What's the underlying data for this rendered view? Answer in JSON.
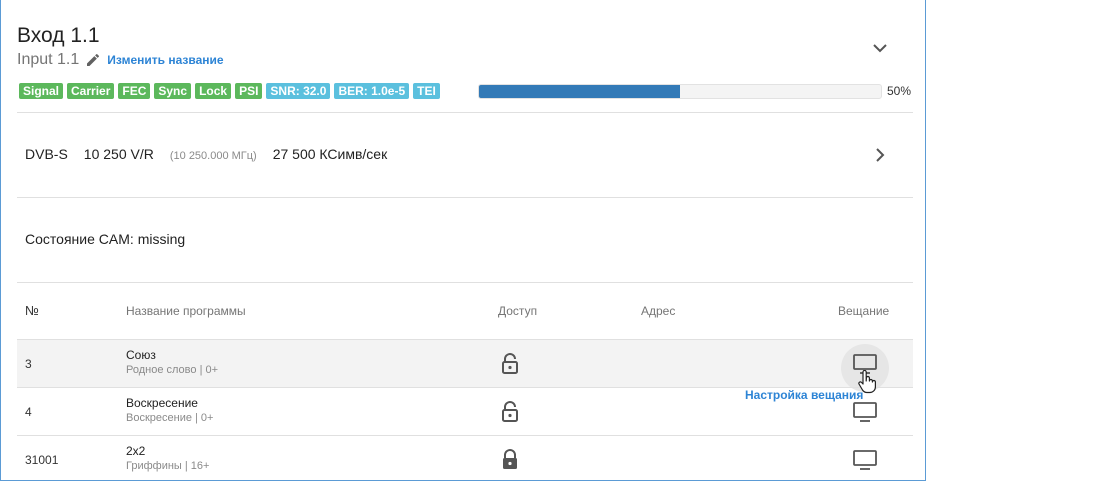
{
  "header": {
    "title": "Вход 1.1",
    "subtitle": "Input 1.1",
    "rename_link": "Изменить название"
  },
  "status": {
    "badges": [
      {
        "label": "Signal",
        "color": "#5cb85c"
      },
      {
        "label": "Carrier",
        "color": "#5cb85c"
      },
      {
        "label": "FEC",
        "color": "#5cb85c"
      },
      {
        "label": "Sync",
        "color": "#5cb85c"
      },
      {
        "label": "Lock",
        "color": "#5cb85c"
      },
      {
        "label": "PSI",
        "color": "#5cb85c"
      },
      {
        "label": "SNR: 32.0",
        "color": "#5bc0de"
      },
      {
        "label": "BER: 1.0e-5",
        "color": "#5bc0de"
      },
      {
        "label": "TEI",
        "color": "#5bc0de"
      }
    ],
    "progress_value": 50,
    "progress_text": "50%",
    "progress_color": "#337ab7"
  },
  "tuning": {
    "standard": "DVB-S",
    "frequency": "10 250 V/R",
    "frequency_mhz": "(10 250.000 МГц)",
    "symbol_rate": "27 500 КСимв/сек"
  },
  "cam": {
    "label": "Состояние CAM:",
    "value": "missing"
  },
  "table": {
    "headers": {
      "num": "№",
      "name": "Название программы",
      "access": "Доступ",
      "address": "Адрес",
      "broadcast": "Вещание"
    },
    "rows": [
      {
        "num": "3",
        "name": "Союз",
        "sub": "Родное слово | 0+",
        "access": "unlocked",
        "address": ""
      },
      {
        "num": "4",
        "name": "Воскресение",
        "sub": "Воскресение | 0+",
        "access": "unlocked",
        "address": ""
      },
      {
        "num": "31001",
        "name": "2x2",
        "sub": "Гриффины | 16+",
        "access": "locked",
        "address": ""
      }
    ]
  },
  "tooltip": "Настройка вещания",
  "icons": {
    "edit": "pencil-icon",
    "collapse": "chevron-down-icon",
    "expand": "chevron-right-icon",
    "unlocked": "lock-open-icon",
    "locked": "lock-icon",
    "broadcast": "monitor-icon",
    "cursor": "hand-pointer-icon"
  }
}
